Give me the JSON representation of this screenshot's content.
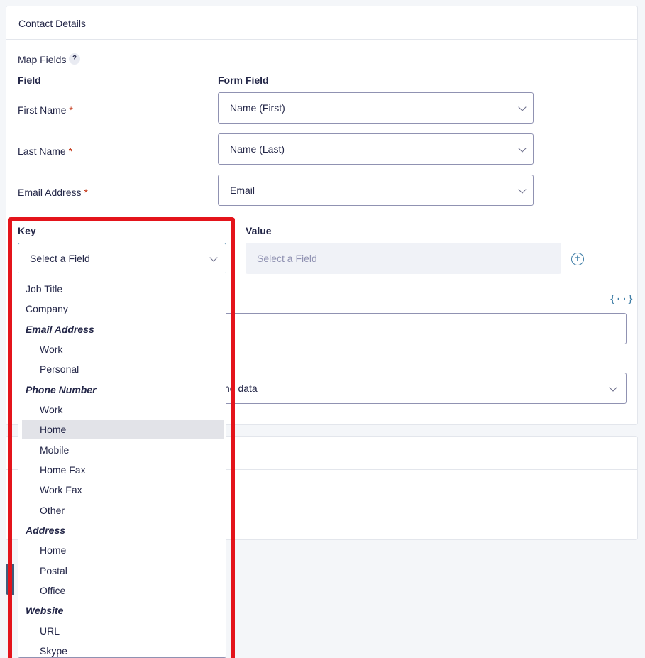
{
  "card": {
    "title": "Contact Details"
  },
  "map_fields": {
    "label": "Map Fields",
    "help": "?",
    "col_field": "Field",
    "col_form_field": "Form Field",
    "required_marker": "*",
    "rows": [
      {
        "label": "First Name",
        "value": "Name (First)"
      },
      {
        "label": "Last Name",
        "value": "Name (Last)"
      },
      {
        "label": "Email Address",
        "value": "Email"
      }
    ]
  },
  "custom": {
    "key_label": "Key",
    "value_label": "Value",
    "key_placeholder": "Select a Field",
    "value_placeholder": "Select a Field",
    "add": "+"
  },
  "merge_tag": "{··}",
  "partial_select": {
    "value": "ng data"
  },
  "dropdown": {
    "options": [
      {
        "label": "Job Title",
        "type": "option"
      },
      {
        "label": "Company",
        "type": "option"
      },
      {
        "label": "Email Address",
        "type": "group"
      },
      {
        "label": "Work",
        "type": "child"
      },
      {
        "label": "Personal",
        "type": "child"
      },
      {
        "label": "Phone Number",
        "type": "group"
      },
      {
        "label": "Work",
        "type": "child"
      },
      {
        "label": "Home",
        "type": "child",
        "highlighted": true
      },
      {
        "label": "Mobile",
        "type": "child"
      },
      {
        "label": "Home Fax",
        "type": "child"
      },
      {
        "label": "Work Fax",
        "type": "child"
      },
      {
        "label": "Other",
        "type": "child"
      },
      {
        "label": "Address",
        "type": "group"
      },
      {
        "label": "Home",
        "type": "child"
      },
      {
        "label": "Postal",
        "type": "child"
      },
      {
        "label": "Office",
        "type": "child"
      },
      {
        "label": "Website",
        "type": "group"
      },
      {
        "label": "URL",
        "type": "child"
      },
      {
        "label": "Skype",
        "type": "child"
      }
    ]
  },
  "colors": {
    "accent": "#3e7da6",
    "highlight": "#e4141b",
    "required": "#c02b0a"
  }
}
